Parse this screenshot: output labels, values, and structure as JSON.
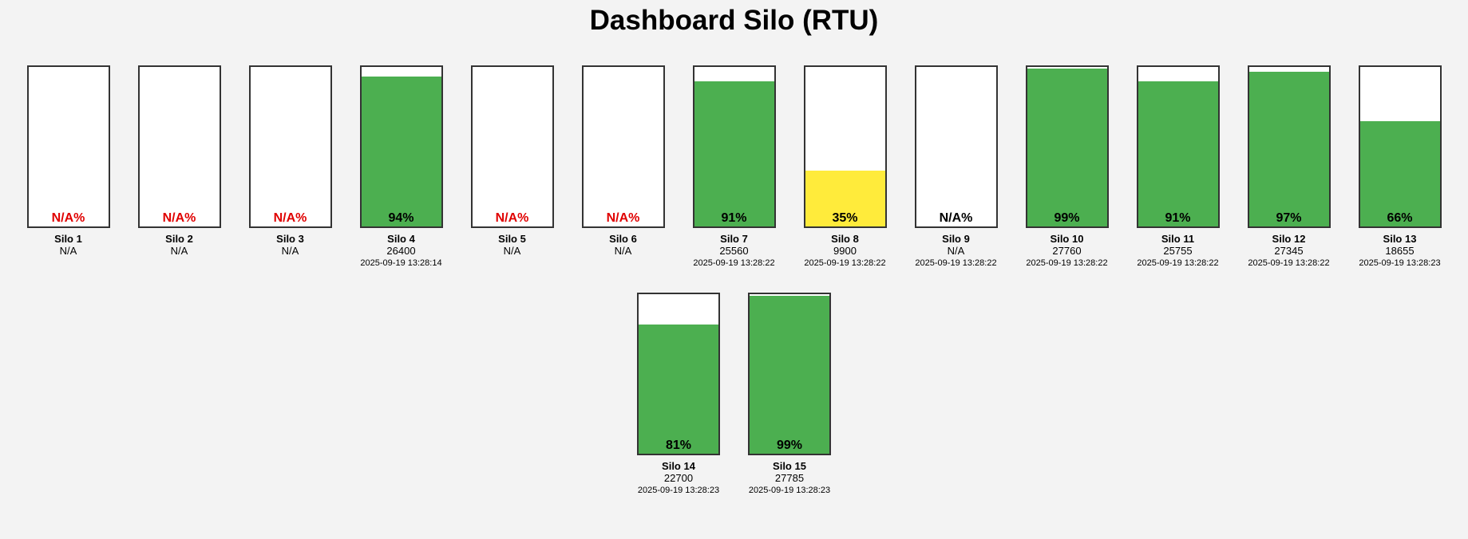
{
  "title": "Dashboard Silo (RTU)",
  "colors": {
    "fill_normal": "#4caf50",
    "fill_low": "#ffeb3b",
    "na_text": "#e00000",
    "pct_text": "#000000"
  },
  "silos": [
    {
      "name": "Silo 1",
      "percent_label": "N/A%",
      "level": null,
      "value": "N/A",
      "timestamp": "",
      "status": "na"
    },
    {
      "name": "Silo 2",
      "percent_label": "N/A%",
      "level": null,
      "value": "N/A",
      "timestamp": "",
      "status": "na"
    },
    {
      "name": "Silo 3",
      "percent_label": "N/A%",
      "level": null,
      "value": "N/A",
      "timestamp": "",
      "status": "na"
    },
    {
      "name": "Silo 4",
      "percent_label": "94%",
      "level": 94,
      "value": "26400",
      "timestamp": "2025-09-19 13:28:14",
      "status": "normal"
    },
    {
      "name": "Silo 5",
      "percent_label": "N/A%",
      "level": null,
      "value": "N/A",
      "timestamp": "",
      "status": "na"
    },
    {
      "name": "Silo 6",
      "percent_label": "N/A%",
      "level": null,
      "value": "N/A",
      "timestamp": "",
      "status": "na"
    },
    {
      "name": "Silo 7",
      "percent_label": "91%",
      "level": 91,
      "value": "25560",
      "timestamp": "2025-09-19 13:28:22",
      "status": "normal"
    },
    {
      "name": "Silo 8",
      "percent_label": "35%",
      "level": 35,
      "value": "9900",
      "timestamp": "2025-09-19 13:28:22",
      "status": "low"
    },
    {
      "name": "Silo 9",
      "percent_label": "N/A%",
      "level": null,
      "value": "N/A",
      "timestamp": "2025-09-19 13:28:22",
      "status": "na-dark"
    },
    {
      "name": "Silo 10",
      "percent_label": "99%",
      "level": 99,
      "value": "27760",
      "timestamp": "2025-09-19 13:28:22",
      "status": "normal"
    },
    {
      "name": "Silo 11",
      "percent_label": "91%",
      "level": 91,
      "value": "25755",
      "timestamp": "2025-09-19 13:28:22",
      "status": "normal"
    },
    {
      "name": "Silo 12",
      "percent_label": "97%",
      "level": 97,
      "value": "27345",
      "timestamp": "2025-09-19 13:28:22",
      "status": "normal"
    },
    {
      "name": "Silo 13",
      "percent_label": "66%",
      "level": 66,
      "value": "18655",
      "timestamp": "2025-09-19 13:28:23",
      "status": "normal"
    },
    {
      "name": "Silo 14",
      "percent_label": "81%",
      "level": 81,
      "value": "22700",
      "timestamp": "2025-09-19 13:28:23",
      "status": "normal"
    },
    {
      "name": "Silo 15",
      "percent_label": "99%",
      "level": 99,
      "value": "27785",
      "timestamp": "2025-09-19 13:28:23",
      "status": "normal"
    }
  ]
}
